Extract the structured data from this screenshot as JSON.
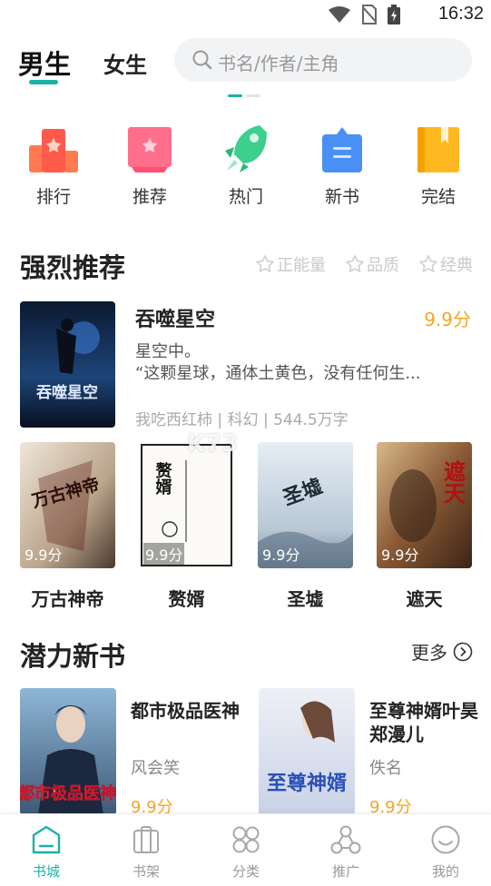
{
  "status_bar": {
    "time": "16:32"
  },
  "header": {
    "tabs": [
      {
        "label": "男生",
        "active": true
      },
      {
        "label": "女生",
        "active": false
      }
    ],
    "search_placeholder": "书名/作者/主角"
  },
  "categories": [
    {
      "label": "排行",
      "icon": "ranking-icon"
    },
    {
      "label": "推荐",
      "icon": "recommend-icon"
    },
    {
      "label": "热门",
      "icon": "rocket-icon"
    },
    {
      "label": "新书",
      "icon": "new-book-icon"
    },
    {
      "label": "完结",
      "icon": "completed-icon"
    }
  ],
  "recommend": {
    "title": "强烈推荐",
    "tags": [
      "正能量",
      "品质",
      "经典"
    ],
    "featured": {
      "title": "吞噬星空",
      "score": "9.9分",
      "line1": "星空中。",
      "line2": "“这颗星球，通体土黄色，没有任何生...",
      "meta": "我吃西红柿 | 科幻 | 544.5万字",
      "cover_text": "吞噬星空"
    },
    "books": [
      {
        "name": "万古神帝",
        "score": "9.9分",
        "cover_text": "万古神帝"
      },
      {
        "name": "赘婿",
        "score": "9.9分",
        "cover_text": "赘婿"
      },
      {
        "name": "圣墟",
        "score": "9.9分",
        "cover_text": "圣墟"
      },
      {
        "name": "遮天",
        "score": "9.9分",
        "cover_text": "遮天"
      }
    ]
  },
  "new_books": {
    "title": "潜力新书",
    "more_label": "更多",
    "items": [
      {
        "title": "都市极品医神",
        "author": "风会笑",
        "score": "9.9分",
        "cover_text": "都市极品医神"
      },
      {
        "title": "至尊神婿叶昊郑漫儿",
        "author": "佚名",
        "score": "9.9分",
        "cover_text": "至尊神婿"
      }
    ]
  },
  "bottom_nav": [
    {
      "label": "书城",
      "icon": "bookstore-icon",
      "active": true
    },
    {
      "label": "书架",
      "icon": "bookshelf-icon",
      "active": false
    },
    {
      "label": "分类",
      "icon": "category-icon",
      "active": false
    },
    {
      "label": "推广",
      "icon": "share-icon",
      "active": false
    },
    {
      "label": "我的",
      "icon": "profile-icon",
      "active": false
    }
  ],
  "watermark": "K73",
  "colors": {
    "accent": "#19b3a5",
    "score": "#f5a623"
  }
}
